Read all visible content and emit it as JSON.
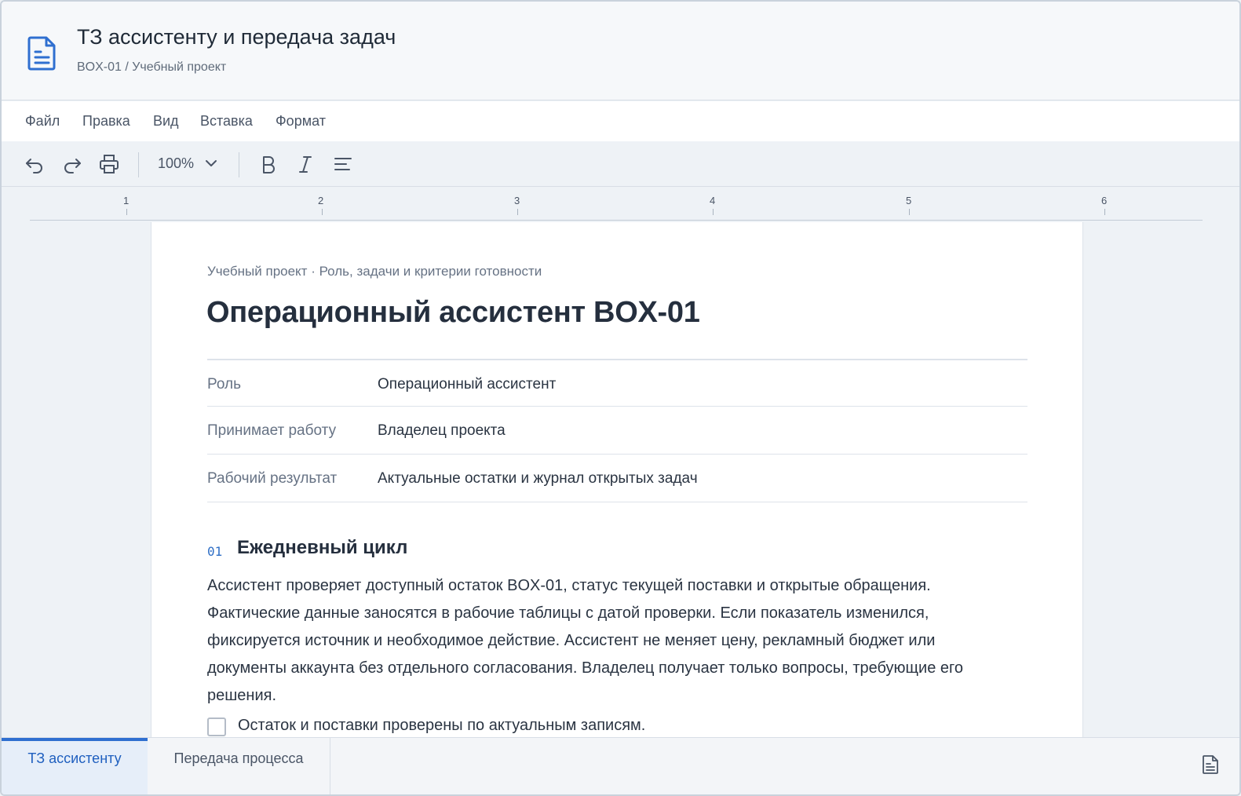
{
  "header": {
    "title": "ТЗ ассистенту и передача задач",
    "path": "BOX-01 / Учебный проект",
    "icon": "document-icon"
  },
  "menu": [
    "Файл",
    "Правка",
    "Вид",
    "Вставка",
    "Формат"
  ],
  "toolbar": {
    "zoom": "100%",
    "icons": [
      "undo-icon",
      "redo-icon",
      "print-icon",
      "chevron-down-icon",
      "bold-icon",
      "italic-icon",
      "align-icon"
    ]
  },
  "ruler": [
    "1",
    "2",
    "3",
    "4",
    "5",
    "6"
  ],
  "document": {
    "kicker": "Учебный проект · Роль, задачи и критерии готовности",
    "heading": "Операционный ассистент BOX-01",
    "meta": [
      {
        "key": "Роль",
        "value": "Операционный ассистент"
      },
      {
        "key": "Принимает работу",
        "value": "Владелец проекта"
      },
      {
        "key": "Рабочий результат",
        "value": "Актуальные остатки и журнал открытых задач"
      }
    ],
    "section": {
      "number": "01",
      "title": "Ежедневный цикл",
      "lines": [
        "Ассистент проверяет доступный остаток BOX-01, статус текущей поставки и открытые обращения.",
        "Фактические данные заносятся в рабочие таблицы с датой проверки. Если показатель изменился,",
        "фиксируется источник и необходимое действие. Ассистент не меняет цену, рекламный бюджет или",
        "документы аккаунта без отдельного согласования. Владелец получает только вопросы, требующие его",
        "решения."
      ],
      "checklist": [
        {
          "label": "Остаток и поставки проверены по актуальным записям.",
          "checked": false
        }
      ]
    }
  },
  "tabs": [
    {
      "label": "ТЗ ассистенту",
      "active": true
    },
    {
      "label": "Передача процесса",
      "active": false
    }
  ],
  "colors": {
    "accent": "#2f6fd0",
    "text": "#1f2a37",
    "muted": "#667284"
  }
}
